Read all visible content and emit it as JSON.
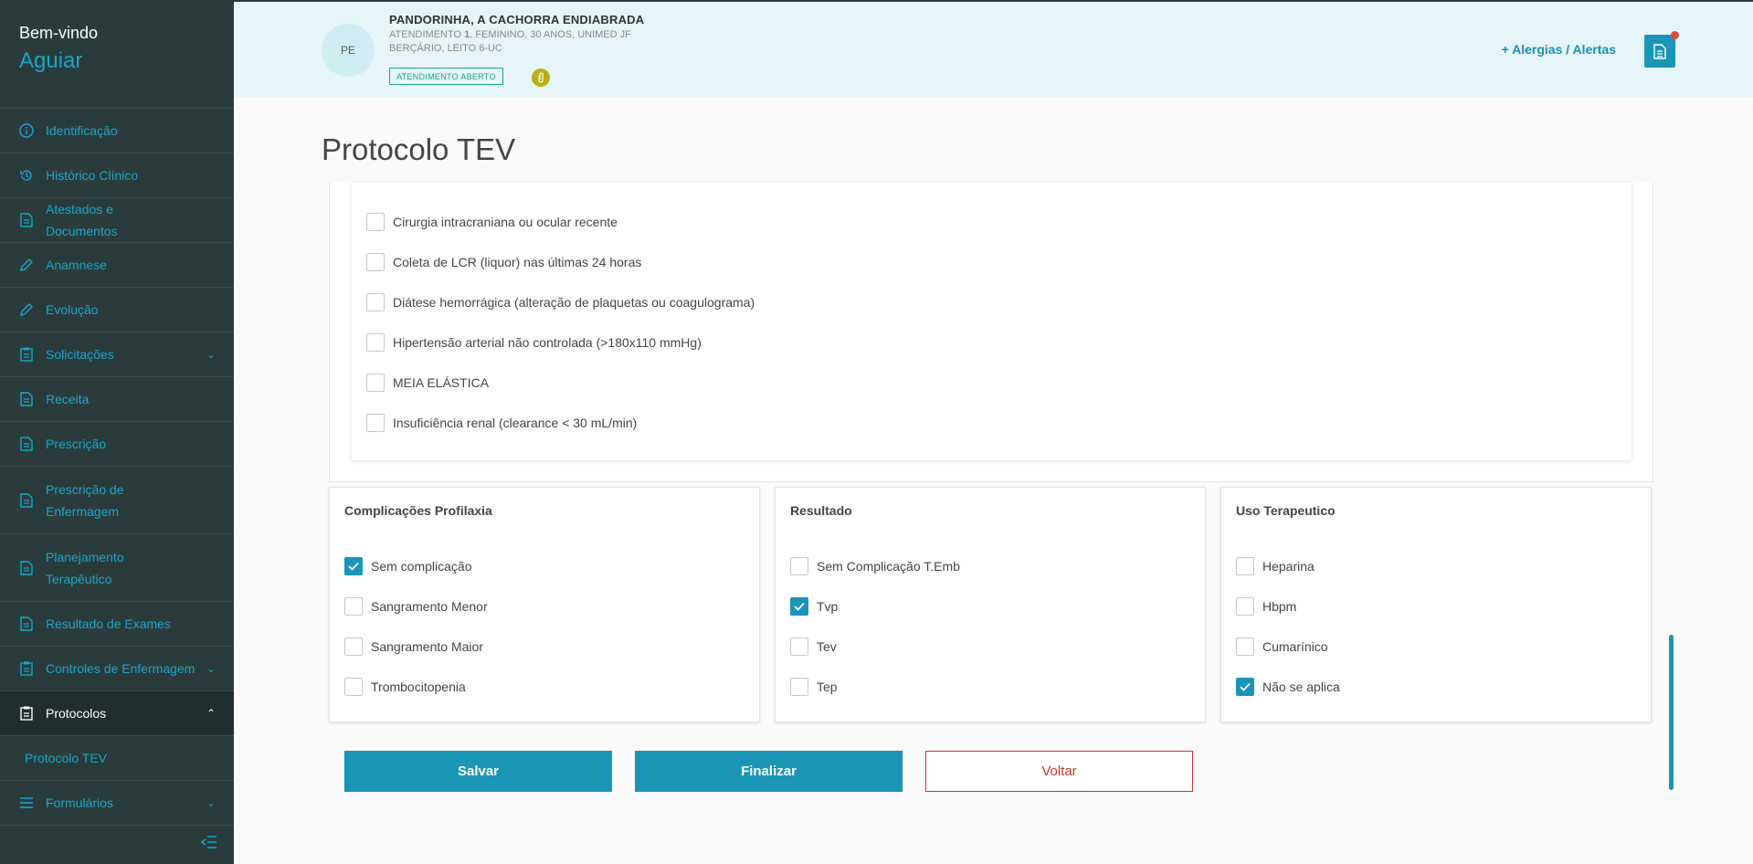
{
  "sidebar": {
    "welcome": "Bem-vindo",
    "user": "Aguiar",
    "items": [
      {
        "label": "Identificação",
        "icon": "info-icon"
      },
      {
        "label": "Histórico Clínico",
        "icon": "history-icon"
      },
      {
        "label": "Atestados e Documentos",
        "icon": "document-icon"
      },
      {
        "label": "Anamnese",
        "icon": "pencil-icon"
      },
      {
        "label": "Evolução",
        "icon": "pencil-icon"
      },
      {
        "label": "Solicitações",
        "icon": "clipboard-icon"
      },
      {
        "label": "Receita",
        "icon": "document-icon"
      },
      {
        "label": "Prescrição",
        "icon": "document-icon"
      },
      {
        "label": "Prescrição de Enfermagem",
        "icon": "document-icon"
      },
      {
        "label": "Planejamento Terapêutico",
        "icon": "document-icon"
      },
      {
        "label": "Resultado de Exames",
        "icon": "document-icon"
      },
      {
        "label": "Controles de Enfermagem",
        "icon": "clipboard-icon"
      },
      {
        "label": "Protocolos",
        "icon": "clipboard-icon"
      },
      {
        "label": "Formulários",
        "icon": "list-icon"
      }
    ],
    "sub_item": "Protocolo TEV"
  },
  "patient": {
    "initials": "PE",
    "name": "PANDORINHA, A CACHORRA ENDIABRADA",
    "info_prefix": "ATENDIMENTO ",
    "info_number": "1",
    "info_rest": ", FEMININO, 30 ANOS, UNIMED JF",
    "bed": "BERÇÁRIO, LEITO 6-UC",
    "status": "ATENDIMENTO ABERTO"
  },
  "header": {
    "alerts": "+  Alergias / Alertas"
  },
  "page_title": "Protocolo TEV",
  "contraindications": [
    {
      "label": "Cirurgia intracraniana ou ocular recente",
      "checked": false
    },
    {
      "label": "Coleta de LCR (liquor) nas últimas 24 horas",
      "checked": false
    },
    {
      "label": "Diátese hemorrágica (alteração de plaquetas ou coagulograma)",
      "checked": false
    },
    {
      "label": "Hipertensão arterial não controlada (>180x110 mmHg)",
      "checked": false
    },
    {
      "label": "MEIA ELÁSTICA",
      "checked": false
    },
    {
      "label": "Insuficiência renal (clearance < 30 mL/min)",
      "checked": false
    }
  ],
  "cards": [
    {
      "title": "Complicações Profilaxia",
      "options": [
        {
          "label": "Sem complicação",
          "checked": true
        },
        {
          "label": "Sangramento Menor",
          "checked": false
        },
        {
          "label": "Sangramento Maior",
          "checked": false
        },
        {
          "label": "Trombocitopenia",
          "checked": false
        }
      ]
    },
    {
      "title": "Resultado",
      "options": [
        {
          "label": "Sem Complicação T.Emb",
          "checked": false
        },
        {
          "label": "Tvp",
          "checked": true
        },
        {
          "label": "Tev",
          "checked": false
        },
        {
          "label": "Tep",
          "checked": false
        }
      ]
    },
    {
      "title": "Uso Terapeutico",
      "options": [
        {
          "label": "Heparina",
          "checked": false
        },
        {
          "label": "Hbpm",
          "checked": false
        },
        {
          "label": "Cumarínico",
          "checked": false
        },
        {
          "label": "Não se aplica",
          "checked": true
        }
      ]
    }
  ],
  "buttons": {
    "save": "Salvar",
    "finish": "Finalizar",
    "back": "Voltar"
  },
  "colors": {
    "accent": "#1a95b6",
    "sidebar": "#2a3b3c",
    "danger": "#d0342c",
    "status": "#1aa68a"
  }
}
